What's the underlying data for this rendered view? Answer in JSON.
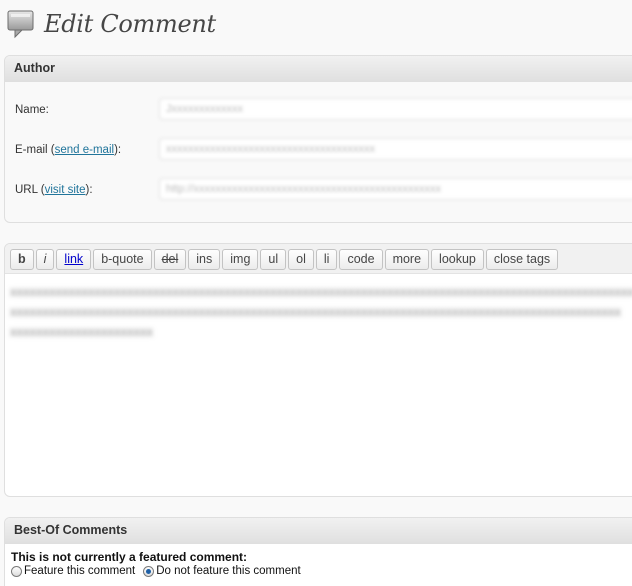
{
  "header": {
    "title": "Edit Comment",
    "icon": "comment-bubble-icon"
  },
  "author": {
    "title": "Author",
    "name_label": "Name:",
    "name_value": "Jxxxxxxxxxxxxx",
    "email_label_prefix": "E-mail (",
    "email_link": "send e-mail",
    "email_label_suffix": "):",
    "email_value": "xxxxxxxxxxxxxxxxxxxxxxxxxxxxxxxxxxxxxx",
    "url_label_prefix": "URL (",
    "url_link": "visit site",
    "url_label_suffix": "):",
    "url_value": "http://xxxxxxxxxxxxxxxxxxxxxxxxxxxxxxxxxxxxxxxxxxxxx"
  },
  "quicktags": [
    "b",
    "i",
    "link",
    "b-quote",
    "del",
    "ins",
    "img",
    "ul",
    "ol",
    "li",
    "code",
    "more",
    "lookup",
    "close tags"
  ],
  "comment_text": "xxxxxxxxxxxxxxxxxxxxxxxxxxxxxxxxxxxxxxxxxxxxxxxxxxxxxxxxxxxxxxxxxxxxxxxxxxxxxxxxxxxxxxxxxxxxxxxx\nxxxxxxxxxxxxxxxxxxxxxxxxxxxxxxxxxxxxxxxxxxxxxxxxxxxxxxxxxxxxxxxxxxxxxxxxxxxxxxxxxxxxxxxxxxxxxx\nxxxxxxxxxxxxxxxxxxxxxx",
  "bestof": {
    "title": "Best-Of Comments",
    "status": "This is not currently a featured comment:",
    "option_feature": "Feature this comment",
    "option_no_feature": "Do not feature this comment",
    "selected": "option_no_feature"
  }
}
